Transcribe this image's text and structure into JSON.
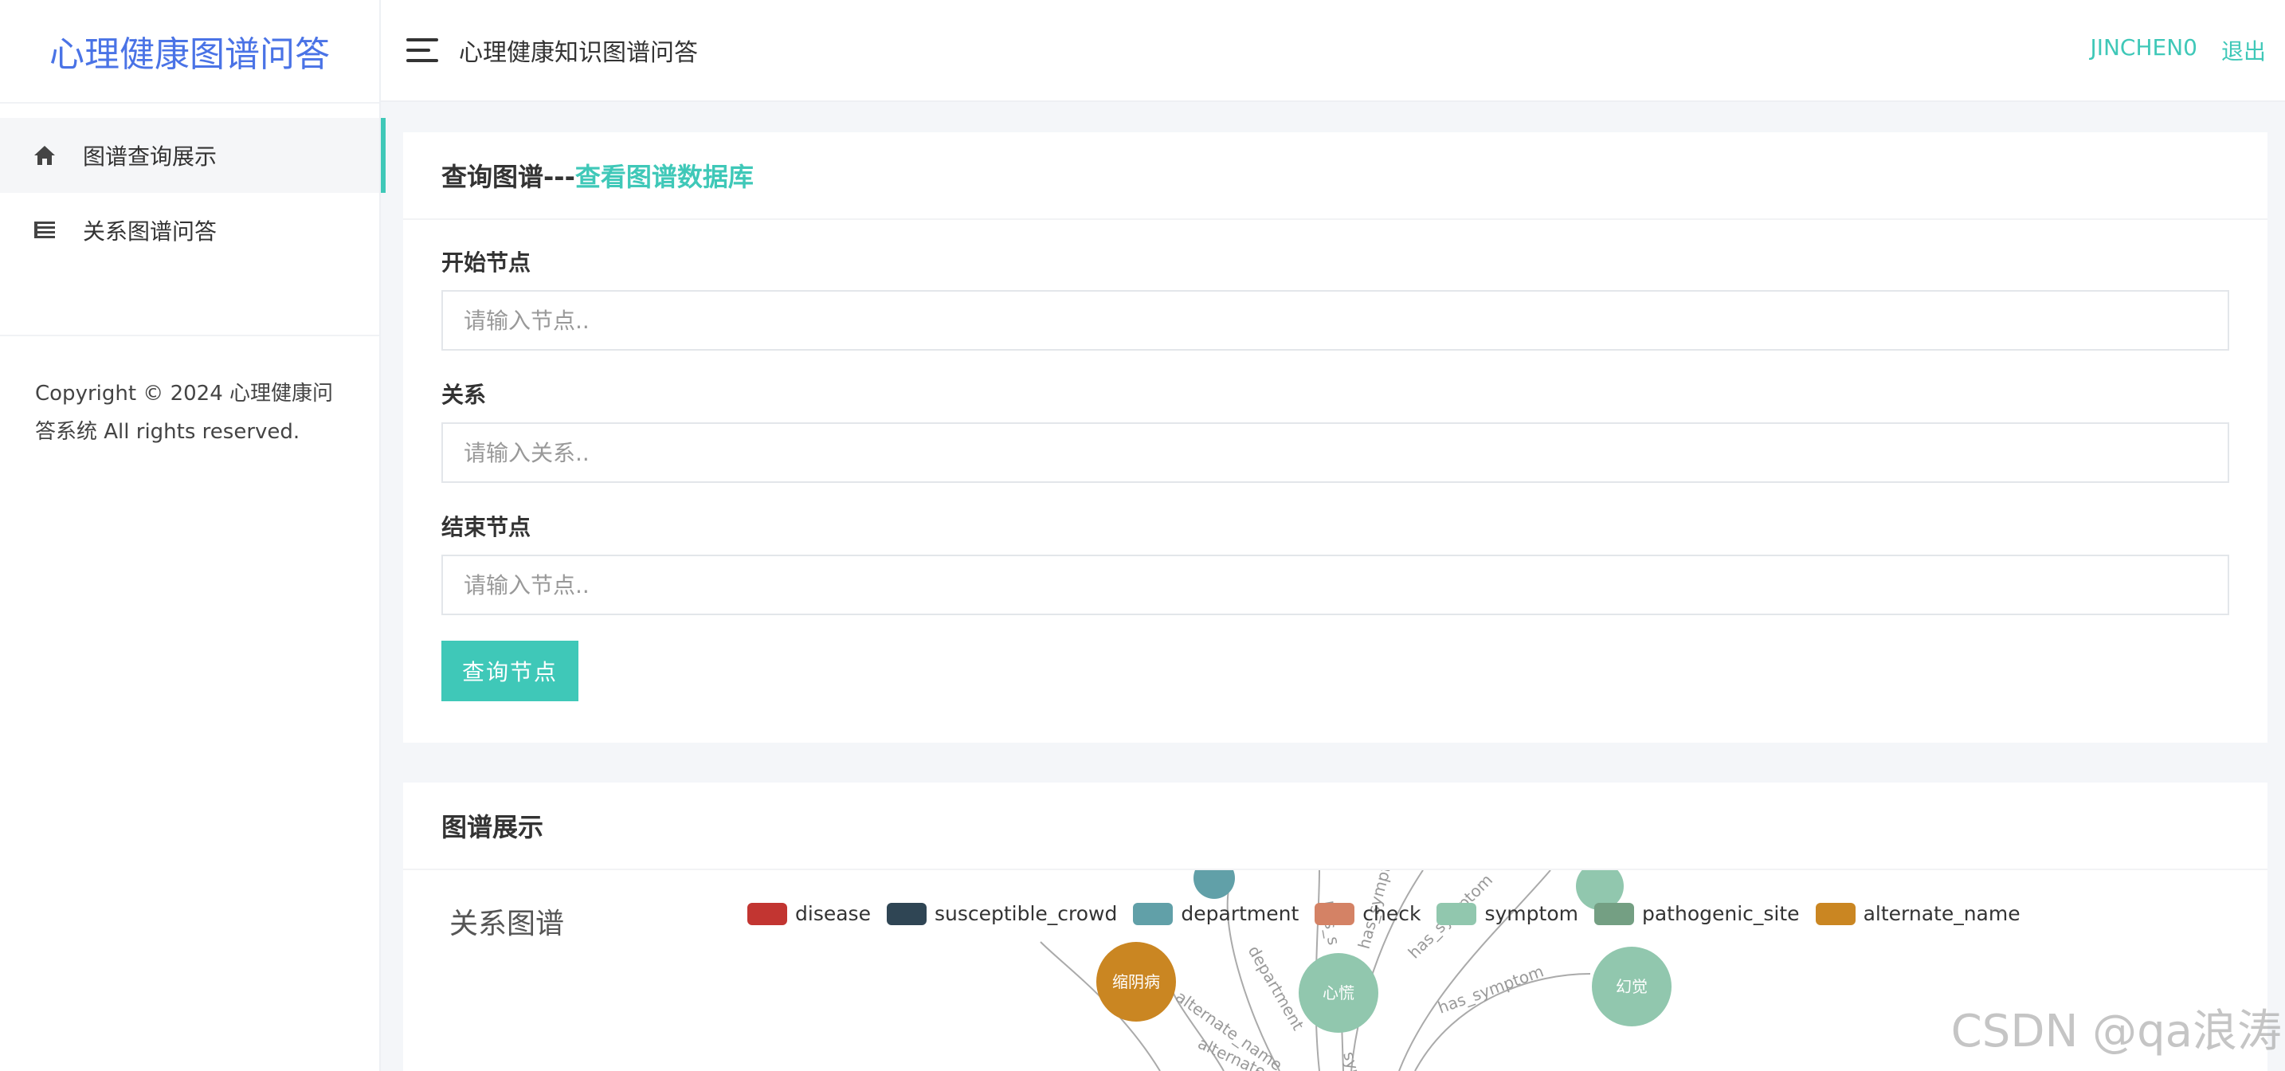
{
  "brand": "心理健康图谱问答",
  "sidebar": {
    "items": [
      {
        "label": "图谱查询展示",
        "icon": "home-icon",
        "active": true
      },
      {
        "label": "关系图谱问答",
        "icon": "list-icon",
        "active": false
      }
    ],
    "copyright": "Copyright © 2024 心理健康问答系统 All rights reserved."
  },
  "topbar": {
    "title": "心理健康知识图谱问答",
    "user": "JINCHEN0",
    "logout": "退出"
  },
  "query_card": {
    "title_prefix": "查询图谱---",
    "title_link": "查看图谱数据库",
    "start_label": "开始节点",
    "start_placeholder": "请输入节点..",
    "relation_label": "关系",
    "relation_placeholder": "请输入关系..",
    "end_label": "结束节点",
    "end_placeholder": "请输入节点..",
    "submit": "查询节点"
  },
  "graph_card": {
    "title": "图谱展示",
    "chart_title": "关系图谱",
    "legend": [
      {
        "name": "disease",
        "color": "#c23531"
      },
      {
        "name": "susceptible_crowd",
        "color": "#2f4554"
      },
      {
        "name": "department",
        "color": "#61a0a8"
      },
      {
        "name": "check",
        "color": "#d48265"
      },
      {
        "name": "symptom",
        "color": "#91c7ae"
      },
      {
        "name": "pathogenic_site",
        "color": "#749f83"
      },
      {
        "name": "alternate_name",
        "color": "#ca8622"
      }
    ],
    "nodes": [
      {
        "name": "缩阴病",
        "category": "alternate_name"
      },
      {
        "name": "心慌",
        "category": "symptom"
      },
      {
        "name": "幻觉",
        "category": "symptom"
      }
    ],
    "edge_labels": [
      "alternate_name",
      "alternate_",
      "department",
      "has_s",
      "has_sympt",
      "has_symptom",
      "has_symptom",
      "sym"
    ]
  },
  "watermark": "CSDN @qa浪涛"
}
